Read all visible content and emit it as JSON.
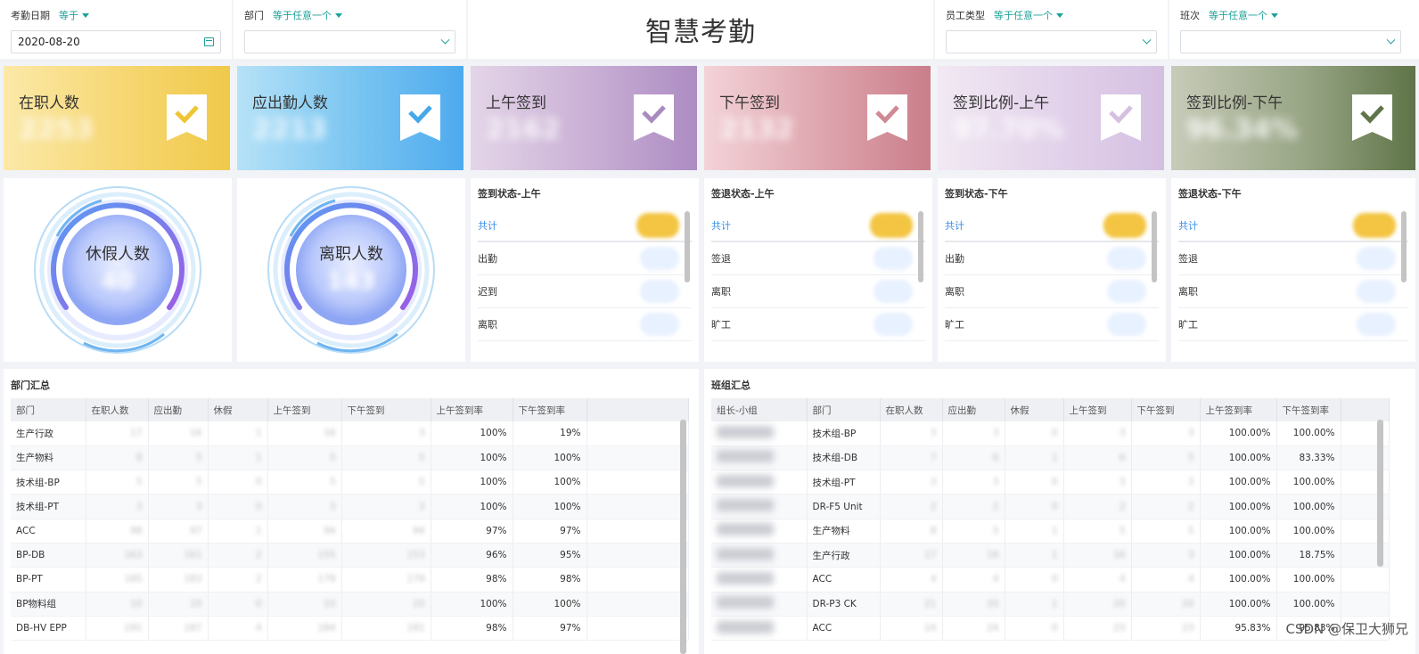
{
  "filters": {
    "date": {
      "label": "考勤日期",
      "op": "等于",
      "value": "2020-08-20"
    },
    "dept": {
      "label": "部门",
      "op": "等于任意一个",
      "value": ""
    },
    "emp_type": {
      "label": "员工类型",
      "op": "等于任意一个",
      "value": ""
    },
    "shift": {
      "label": "班次",
      "op": "等于任意一个",
      "value": ""
    }
  },
  "title": "智慧考勤",
  "kpis": [
    {
      "label": "在职人数",
      "value": "2253",
      "check_color": "#f0c533"
    },
    {
      "label": "应出勤人数",
      "value": "2213",
      "check_color": "#45a8e8"
    },
    {
      "label": "上午签到",
      "value": "2162",
      "check_color": "#a98bc0"
    },
    {
      "label": "下午签到",
      "value": "2132",
      "check_color": "#cf8a95"
    },
    {
      "label": "签到比例-上午",
      "value": "97.70%",
      "check_color": "#d6bfe0"
    },
    {
      "label": "签到比例-下午",
      "value": "96.34%",
      "check_color": "#5f7448"
    }
  ],
  "gauges": [
    {
      "label": "休假人数",
      "value": "40"
    },
    {
      "label": "离职人数",
      "value": "143"
    }
  ],
  "status_panels": [
    {
      "title": "签到状态-上午",
      "rows": [
        "共计",
        "出勤",
        "迟到",
        "离职"
      ]
    },
    {
      "title": "签退状态-上午",
      "rows": [
        "共计",
        "签退",
        "离职",
        "旷工"
      ]
    },
    {
      "title": "签到状态-下午",
      "rows": [
        "共计",
        "出勤",
        "离职",
        "旷工"
      ]
    },
    {
      "title": "签退状态-下午",
      "rows": [
        "共计",
        "签退",
        "离职",
        "旷工"
      ]
    }
  ],
  "dept_table": {
    "title": "部门汇总",
    "headers": [
      "部门",
      "在职人数",
      "应出勤",
      "休假",
      "上午签到",
      "下午签到",
      "上午签到率",
      "下午签到率"
    ],
    "rows": [
      [
        "生产行政",
        "17",
        "16",
        "1",
        "16",
        "3",
        "100%",
        "19%"
      ],
      [
        "生产物料",
        "8",
        "5",
        "1",
        "5",
        "5",
        "100%",
        "100%"
      ],
      [
        "技术组-BP",
        "5",
        "5",
        "0",
        "5",
        "5",
        "100%",
        "100%"
      ],
      [
        "技术组-PT",
        "3",
        "3",
        "0",
        "3",
        "3",
        "100%",
        "100%"
      ],
      [
        "ACC",
        "98",
        "97",
        "1",
        "94",
        "94",
        "97%",
        "97%"
      ],
      [
        "BP-DB",
        "163",
        "161",
        "2",
        "155",
        "153",
        "96%",
        "95%"
      ],
      [
        "BP-PT",
        "185",
        "183",
        "2",
        "179",
        "179",
        "98%",
        "98%"
      ],
      [
        "BP物料组",
        "10",
        "10",
        "0",
        "10",
        "10",
        "100%",
        "100%"
      ],
      [
        "DB-HV EPP",
        "191",
        "187",
        "4",
        "184",
        "181",
        "98%",
        "97%"
      ]
    ]
  },
  "team_table": {
    "title": "班组汇总",
    "headers": [
      "组长-小组",
      "部门",
      "在职人数",
      "应出勤",
      "休假",
      "上午签到",
      "下午签到",
      "上午签到率",
      "下午签到率"
    ],
    "rows": [
      [
        "",
        "技术组-BP",
        "3",
        "3",
        "0",
        "3",
        "3",
        "100.00%",
        "100.00%"
      ],
      [
        "",
        "技术组-DB",
        "7",
        "6",
        "1",
        "6",
        "5",
        "100.00%",
        "83.33%"
      ],
      [
        "",
        "技术组-PT",
        "3",
        "3",
        "0",
        "3",
        "3",
        "100.00%",
        "100.00%"
      ],
      [
        "",
        "DR-F5 Unit",
        "2",
        "2",
        "0",
        "2",
        "2",
        "100.00%",
        "100.00%"
      ],
      [
        "",
        "生产物料",
        "8",
        "5",
        "1",
        "5",
        "5",
        "100.00%",
        "100.00%"
      ],
      [
        "",
        "生产行政",
        "17",
        "16",
        "1",
        "16",
        "3",
        "100.00%",
        "18.75%"
      ],
      [
        "",
        "ACC",
        "4",
        "4",
        "0",
        "4",
        "4",
        "100.00%",
        "100.00%"
      ],
      [
        "",
        "DR-P3 CK",
        "21",
        "20",
        "1",
        "20",
        "20",
        "100.00%",
        "100.00%"
      ],
      [
        "",
        "ACC",
        "24",
        "24",
        "0",
        "23",
        "23",
        "95.83%",
        "95.83%"
      ]
    ]
  },
  "watermark": "CSDN @保卫大狮兄"
}
